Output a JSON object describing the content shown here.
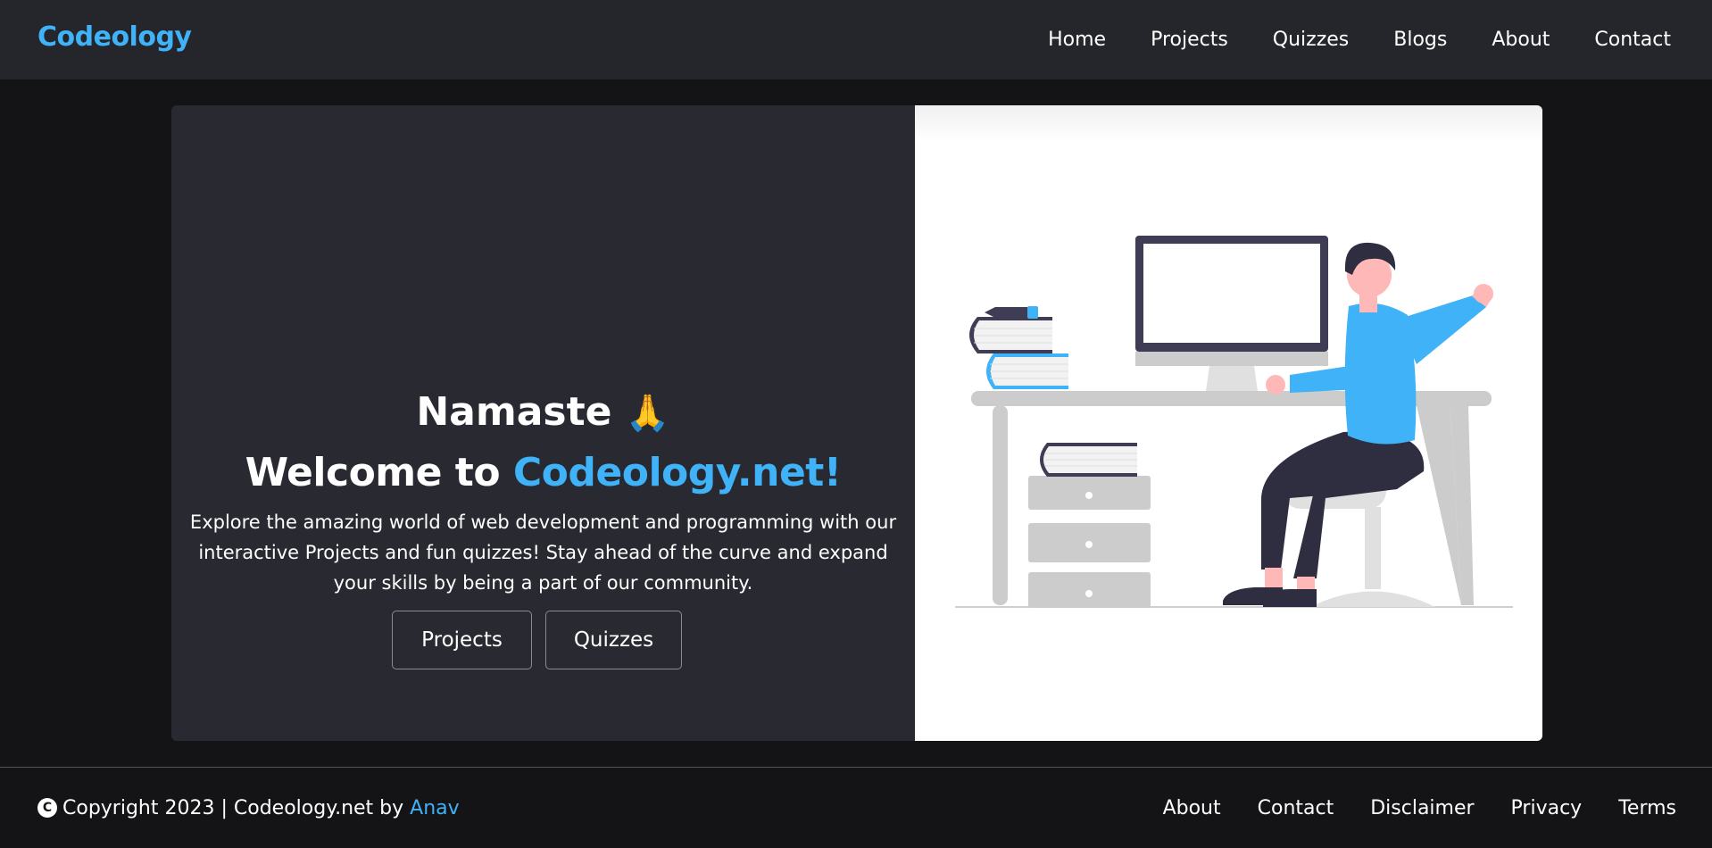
{
  "brand": {
    "name": "Codeology",
    "color": "#3fb2f8"
  },
  "nav": {
    "items": [
      {
        "label": "Home"
      },
      {
        "label": "Projects"
      },
      {
        "label": "Quizzes"
      },
      {
        "label": "Blogs"
      },
      {
        "label": "About"
      },
      {
        "label": "Contact"
      }
    ]
  },
  "hero": {
    "greeting": "Namaste",
    "greeting_emoji": "🙏",
    "welcome_prefix": "Welcome to",
    "welcome_highlight": "Codeology.net!",
    "description": "Explore the amazing world of web development and programming with our interactive Projects and fun quizzes! Stay ahead of the curve and expand your skills by being a part of our community.",
    "buttons": {
      "projects": "Projects",
      "quizzes": "Quizzes"
    },
    "illustration_icon": "developer-at-desk-illustration"
  },
  "footer": {
    "copyright_symbol": "C",
    "copyright_text": "Copyright 2023 | Codeology.net by",
    "author": "Anav",
    "links": [
      {
        "label": "About"
      },
      {
        "label": "Contact"
      },
      {
        "label": "Disclaimer"
      },
      {
        "label": "Privacy"
      },
      {
        "label": "Terms"
      }
    ]
  },
  "colors": {
    "accent": "#3fb2f8",
    "header_bg": "#25262b",
    "page_bg": "#141416",
    "card_bg": "#292a31"
  }
}
